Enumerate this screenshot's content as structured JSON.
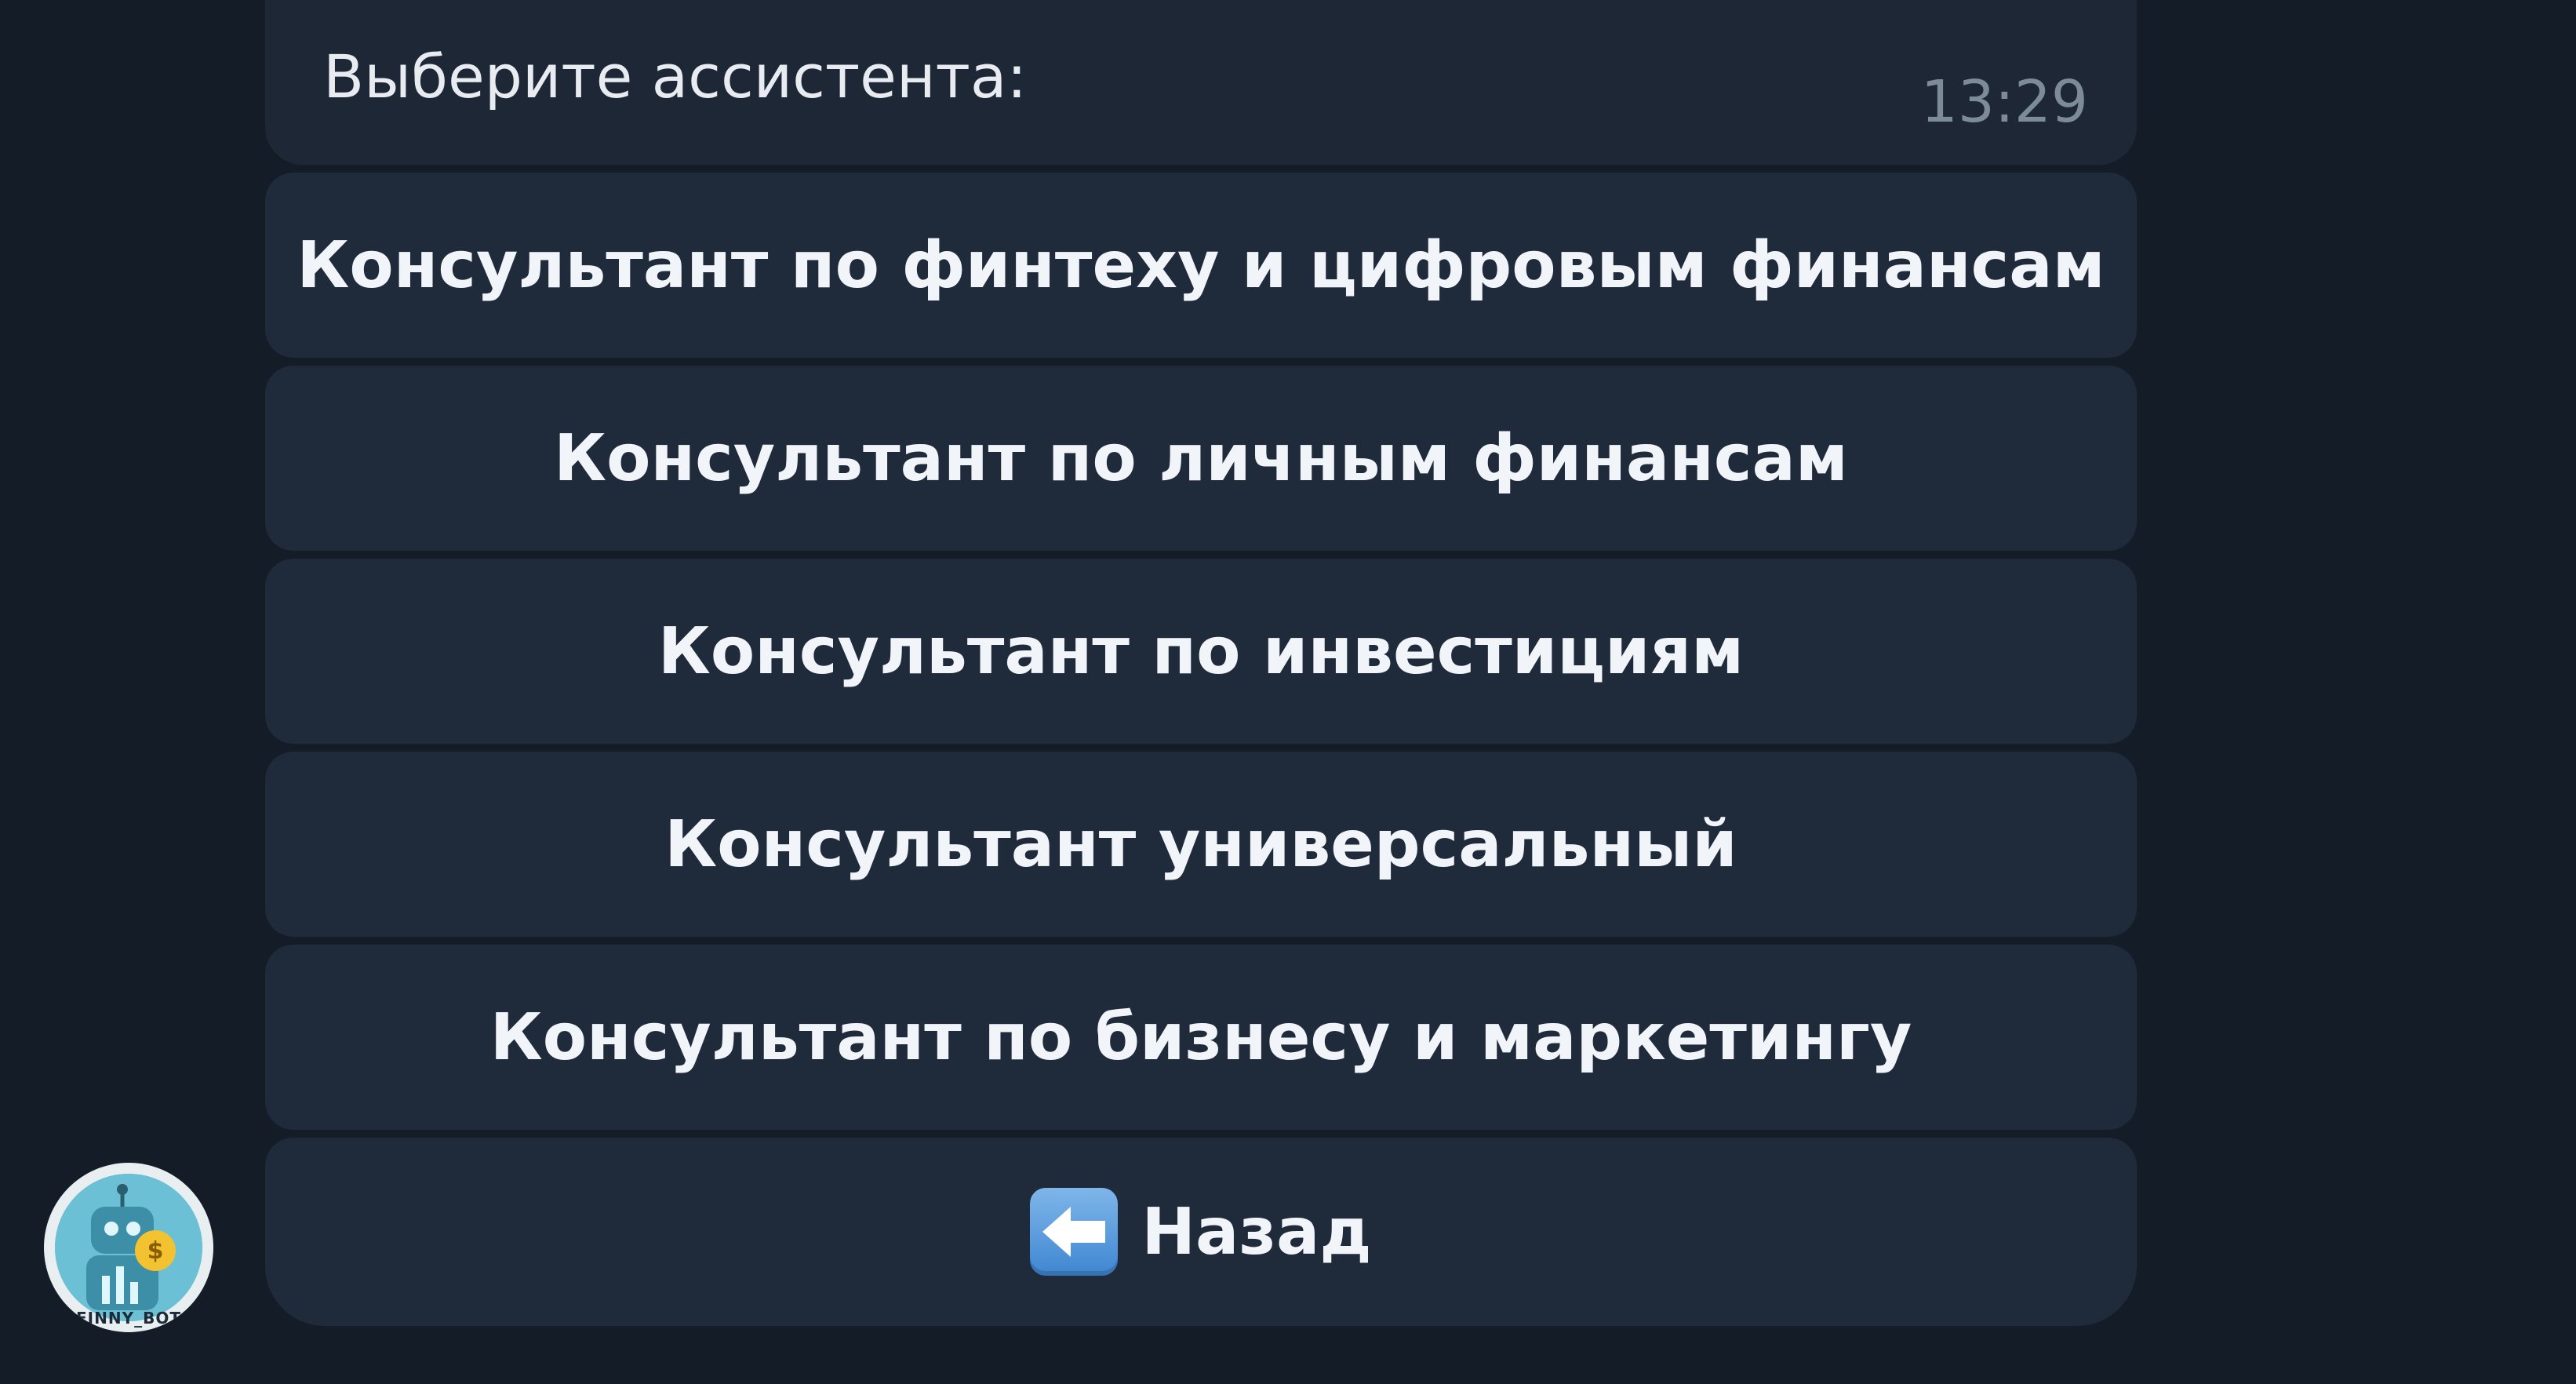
{
  "message": {
    "text": "Выберите ассистента:",
    "time": "13:29"
  },
  "keyboard": {
    "buttons": [
      {
        "label": "Консультант по финтеху и цифровым финансам"
      },
      {
        "label": "Консультант по личным финансам"
      },
      {
        "label": "Консультант по инвестициям"
      },
      {
        "label": "Консультант универсальный"
      },
      {
        "label": "Консультант по бизнесу и маркетингу"
      },
      {
        "label": "Назад",
        "icon": "back-arrow-icon"
      }
    ]
  },
  "avatar": {
    "label": "FINNY_BOT"
  },
  "colors": {
    "background": "#141c27",
    "bubble": "#1d2735",
    "button": "#1f2a3a",
    "text": "#f1f4f8",
    "time": "#7d8b99"
  }
}
